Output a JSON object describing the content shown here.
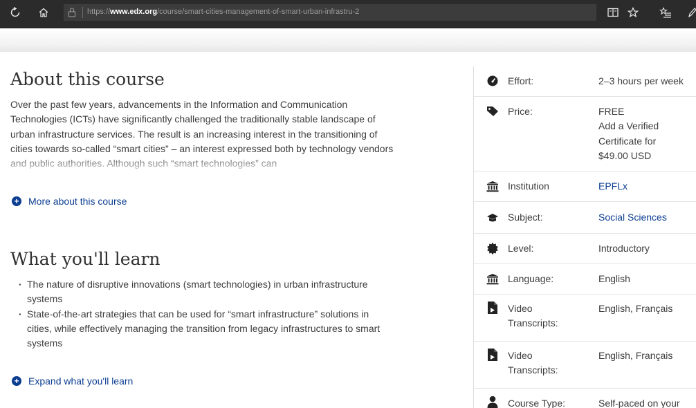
{
  "browser": {
    "url_prefix": "https://",
    "url_host": "www.edx.org",
    "url_path": "/course/smart-cities-management-of-smart-urban-infrastru-2",
    "icons": [
      "refresh-icon",
      "home-icon",
      "lock-icon",
      "reading-view-icon",
      "star-icon",
      "favorites-icon",
      "pen-icon"
    ]
  },
  "about": {
    "title": "About this course",
    "text": "Over the past few years, advancements in the Information and Communication Technologies (ICTs) have significantly challenged the traditionally stable landscape of urban infrastructure services. The result is an increasing interest in the transitioning of cities towards so-called “smart cities” – an interest expressed both by technology vendors and public authorities. Although such “smart technologies” can",
    "more_link": "More about this course"
  },
  "learn": {
    "title": "What you'll learn",
    "items": [
      "The nature of disruptive innovations (smart technologies) in urban infrastructure systems",
      "State-of-the-art strategies that can be used for “smart infrastructure” solutions in cities, while effectively managing the transition from legacy infrastructures to smart systems"
    ],
    "expand_link": "Expand what you'll learn"
  },
  "sidebar": {
    "rows": [
      {
        "icon": "effort-icon",
        "label": "Effort:",
        "value": "2–3 hours per week",
        "link": false
      },
      {
        "icon": "price-tag-icon",
        "label": "Price:",
        "value": "FREE\nAdd a Verified\nCertificate for\n$49.00 USD",
        "link": false
      },
      {
        "icon": "institution-icon",
        "label": "Institution",
        "value": "EPFLx",
        "link": true
      },
      {
        "icon": "graduation-cap-icon",
        "label": "Subject:",
        "value": "Social Sciences",
        "link": true
      },
      {
        "icon": "level-badge-icon",
        "label": "Level:",
        "value": "Introductory",
        "link": false
      },
      {
        "icon": "language-icon",
        "label": "Language:",
        "value": "English",
        "link": false
      },
      {
        "icon": "video-transcript-icon",
        "label": "Video\nTranscripts:",
        "value": "English, Français",
        "link": false
      },
      {
        "icon": "video-transcript-icon",
        "label": "Video\nTranscripts:",
        "value": "English, Français",
        "link": false
      },
      {
        "icon": "person-icon",
        "label": "Course Type:",
        "value": "Self-paced on your",
        "link": false
      }
    ]
  },
  "colors": {
    "link": "#0b3d91",
    "text": "#3c3c3c",
    "chrome": "#2b2b2b"
  }
}
